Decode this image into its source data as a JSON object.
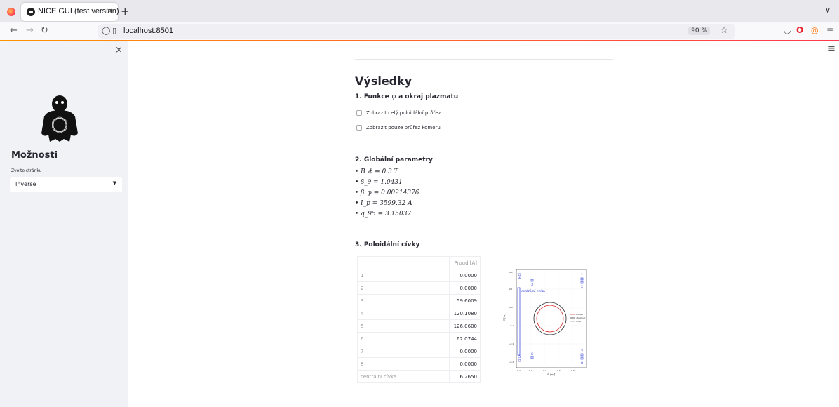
{
  "browser": {
    "tab_title": "NICE GUI (test version)",
    "tab_close": "×",
    "new_tab": "+",
    "tab_list": "∨",
    "url": "localhost:8501",
    "zoom": "90 %"
  },
  "sidebar": {
    "close": "×",
    "heading": "Možnosti",
    "select_label": "Zvolte stránku",
    "select_value": "Inverse"
  },
  "main": {
    "title": "Výsledky",
    "section1": {
      "heading_prefix": "1. Funkce ",
      "heading_psi": "ψ",
      "heading_suffix": " a okraj plazmatu",
      "checkbox1": "Zobrazit celý poloidální průřez",
      "checkbox2": "Zobrazit pouze průřez komoru"
    },
    "section2": {
      "heading": "2. Globální parametry",
      "params": [
        "B_ϕ = 0.3 T",
        "β_θ = 1.0431",
        "β_ϕ = 0.00214376",
        "I_p = 3599.32 A",
        "q_95 = 3.15037"
      ]
    },
    "section3": {
      "heading": "3. Poloidální cívky",
      "table": {
        "column": "Proud [A]",
        "rows": [
          {
            "label": "1",
            "value": "0.0000"
          },
          {
            "label": "2",
            "value": "0.0000"
          },
          {
            "label": "3",
            "value": "59.6009"
          },
          {
            "label": "4",
            "value": "120.1080"
          },
          {
            "label": "5",
            "value": "126.0600"
          },
          {
            "label": "6",
            "value": "62.0744"
          },
          {
            "label": "7",
            "value": "0.0000"
          },
          {
            "label": "8",
            "value": "0.0000"
          },
          {
            "label": "centrální cívka",
            "value": "6.2650"
          }
        ]
      },
      "plot": {
        "coil_label": "centrální cívka",
        "coil_numbers": [
          "1",
          "2",
          "3",
          "4",
          "5",
          "6",
          "7",
          "8"
        ],
        "legend": [
          "limiter",
          "chamber",
          "coils"
        ],
        "xlabel": "R [m]",
        "ylabel": "Z [m]",
        "xticks": [
          "0.2",
          "0.3",
          "0.4",
          "0.5",
          "0.6"
        ],
        "yticks": [
          "0.2",
          "0.1",
          "0.0",
          "−0.1",
          "−0.2",
          "−0.3"
        ]
      }
    }
  },
  "colors": {
    "accent": "#ff4b4b",
    "coil_blue": "#2b3bd6",
    "limiter_red": "#d62728",
    "chamber_black": "#222222",
    "coils_grey": "#999999"
  }
}
